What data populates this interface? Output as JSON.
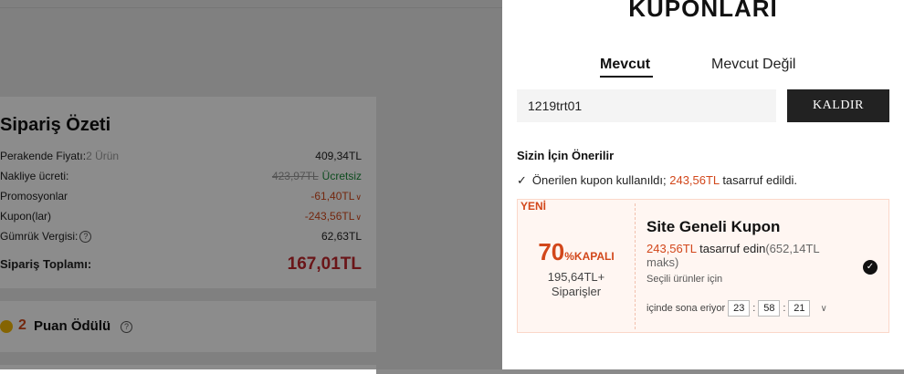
{
  "summary": {
    "title": "Sipariş Özeti",
    "rows": [
      {
        "label": "Perakende Fiyatı:",
        "label_extra": "2 Ürün",
        "value": "409,34TL"
      },
      {
        "label": "Nakliye ücreti:",
        "value": "423,97TL",
        "value_extra": "Ücretsiz"
      },
      {
        "label": "Promosyonlar",
        "value": "-61,40TL"
      },
      {
        "label": "Kupon(lar)",
        "value": "-243,56TL"
      },
      {
        "label": "Gümrük Vergisi:",
        "value": "62,63TL"
      }
    ],
    "total_label": "Sipariş Toplamı:",
    "total_value": "167,01TL"
  },
  "points": {
    "count": "2",
    "label": "Puan Ödülü"
  },
  "drawer": {
    "title": "KUPONLARI",
    "tabs": [
      {
        "label": "Mevcut",
        "active": true
      },
      {
        "label": "Mevcut Değil",
        "active": false
      }
    ],
    "code_value": "1219trt01",
    "remove_label": "KALDIR",
    "recommended_title": "Sizin İçin Önerilir",
    "applied": {
      "text_before": "Önerilen kupon kullanıldı;",
      "amount": "243,56TL",
      "text_after": "tasarruf edildi."
    },
    "coupon": {
      "badge": "YENİ",
      "percent": "70",
      "percent_suffix": "%KAPALI",
      "min_order": "195,64TL+",
      "min_order_label": "Siparişler",
      "title": "Site Geneli Kupon",
      "save_amount": "243,56TL",
      "save_text": "tasarruf edin",
      "save_max": "(652,14TL maks)",
      "scope": "Seçili ürünler için",
      "expiry_label": "içinde sona eriyor",
      "hours": "23",
      "minutes": "58",
      "seconds": "21"
    }
  },
  "colors": {
    "accent": "#d2471b",
    "total": "#c1272d",
    "free": "#1a8a3a",
    "button": "#222222"
  }
}
